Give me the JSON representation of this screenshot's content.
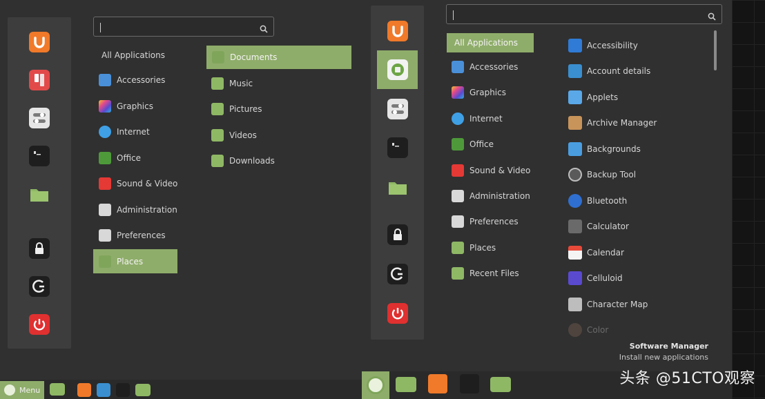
{
  "left_menu": {
    "search": {
      "value": "",
      "placeholder": ""
    },
    "all_applications": "All Applications",
    "categories": [
      {
        "label": "Accessories",
        "icon": "accessories-icon",
        "color": "#4a90d9"
      },
      {
        "label": "Graphics",
        "icon": "graphics-icon",
        "color": "#c85ab8"
      },
      {
        "label": "Internet",
        "icon": "internet-icon",
        "color": "#3fa0e6"
      },
      {
        "label": "Office",
        "icon": "office-icon",
        "color": "#4e9a3a"
      },
      {
        "label": "Sound & Video",
        "icon": "sound-video-icon",
        "color": "#e53935"
      },
      {
        "label": "Administration",
        "icon": "administration-icon",
        "color": "#d8d8d8"
      },
      {
        "label": "Preferences",
        "icon": "preferences-icon",
        "color": "#d8d8d8"
      },
      {
        "label": "Places",
        "icon": "places-icon",
        "color": "#8fad6a",
        "selected": true
      }
    ],
    "places": [
      {
        "label": "Documents",
        "icon": "documents-folder-icon",
        "selected": true
      },
      {
        "label": "Music",
        "icon": "music-folder-icon"
      },
      {
        "label": "Pictures",
        "icon": "pictures-folder-icon"
      },
      {
        "label": "Videos",
        "icon": "videos-folder-icon"
      },
      {
        "label": "Downloads",
        "icon": "downloads-folder-icon"
      }
    ]
  },
  "right_menu": {
    "search": {
      "value": "",
      "placeholder": ""
    },
    "categories": [
      {
        "label": "All Applications",
        "selected": true
      },
      {
        "label": "Accessories",
        "icon": "accessories-icon",
        "color": "#4a90d9"
      },
      {
        "label": "Graphics",
        "icon": "graphics-icon",
        "color": "#c85ab8"
      },
      {
        "label": "Internet",
        "icon": "internet-icon",
        "color": "#3fa0e6"
      },
      {
        "label": "Office",
        "icon": "office-icon",
        "color": "#4e9a3a"
      },
      {
        "label": "Sound & Video",
        "icon": "sound-video-icon",
        "color": "#e53935"
      },
      {
        "label": "Administration",
        "icon": "administration-icon",
        "color": "#d8d8d8"
      },
      {
        "label": "Preferences",
        "icon": "preferences-icon",
        "color": "#d8d8d8"
      },
      {
        "label": "Places",
        "icon": "places-icon",
        "color": "#8fad6a"
      },
      {
        "label": "Recent Files",
        "icon": "recent-files-icon",
        "color": "#8fad6a"
      }
    ],
    "apps": [
      {
        "label": "Accessibility",
        "icon": "accessibility-icon",
        "color": "#2f7bd6"
      },
      {
        "label": "Account details",
        "icon": "account-details-icon",
        "color": "#3a8fd0"
      },
      {
        "label": "Applets",
        "icon": "applets-icon",
        "color": "#5aa8e8"
      },
      {
        "label": "Archive Manager",
        "icon": "archive-manager-icon",
        "color": "#c8945a"
      },
      {
        "label": "Backgrounds",
        "icon": "backgrounds-icon",
        "color": "#4a9ee0"
      },
      {
        "label": "Backup Tool",
        "icon": "backup-tool-icon",
        "color": "#5a5a5a"
      },
      {
        "label": "Bluetooth",
        "icon": "bluetooth-icon",
        "color": "#2f6fd0"
      },
      {
        "label": "Calculator",
        "icon": "calculator-icon",
        "color": "#6a6a6a"
      },
      {
        "label": "Calendar",
        "icon": "calendar-icon",
        "color": "#e84a3a"
      },
      {
        "label": "Celluloid",
        "icon": "celluloid-icon",
        "color": "#5a4ad0"
      },
      {
        "label": "Character Map",
        "icon": "character-map-icon",
        "color": "#bdbdbd"
      },
      {
        "label": "Color",
        "icon": "color-icon",
        "color": "#8a6a5a"
      }
    ],
    "info": {
      "title": "Software Manager",
      "description": "Install new applications"
    }
  },
  "taskbar": {
    "menu_label": "Menu"
  },
  "watermark": "头条 @51CTO观察"
}
